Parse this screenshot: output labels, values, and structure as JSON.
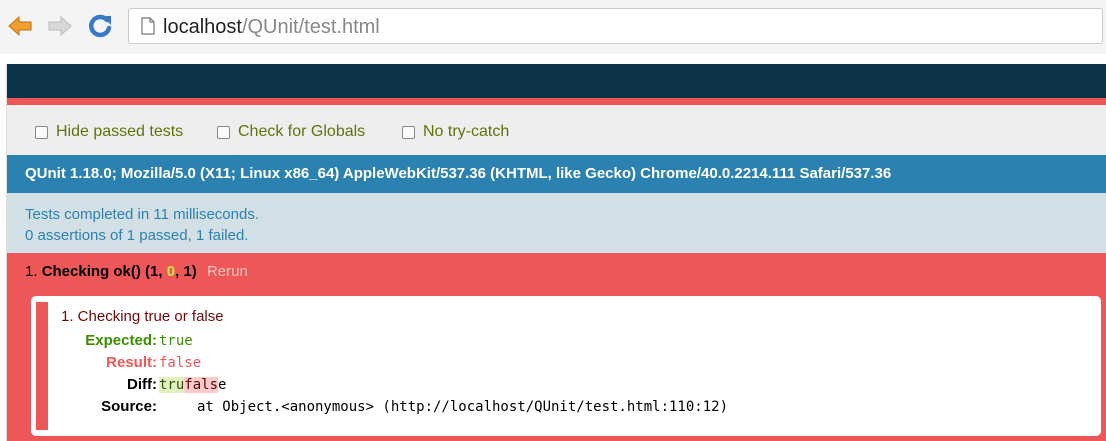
{
  "browser": {
    "url_host": "localhost",
    "url_path": "/QUnit/test.html"
  },
  "qunit": {
    "options": [
      {
        "label": "Hide passed tests",
        "checked": false
      },
      {
        "label": "Check for Globals",
        "checked": false
      },
      {
        "label": "No try-catch",
        "checked": false
      }
    ],
    "user_agent": "QUnit 1.18.0; Mozilla/5.0 (X11; Linux x86_64) AppleWebKit/537.36 (KHTML, like Gecko) Chrome/40.0.2214.111 Safari/537.36",
    "result_line1": "Tests completed in 11 milliseconds.",
    "result_line2": "0 assertions of 1 passed, 1 failed.",
    "test": {
      "number": "1.",
      "name": "Checking ok()",
      "failed_count": "1",
      "passed_count": "0",
      "total_count": "1",
      "rerun_label": "Rerun",
      "assertion": {
        "message": "1. Checking true or false",
        "expected_label": "Expected:",
        "expected_value": "true",
        "result_label": "Result:",
        "result_value": "false",
        "diff_label": "Diff:",
        "diff_inserted": "tru",
        "diff_deleted": "fals",
        "diff_common": "e",
        "source_label": "Source:",
        "source_value": "at Object.<anonymous> (http://localhost/QUnit/test.html:110:12)"
      }
    }
  },
  "colors": {
    "header": "#0d3349",
    "banner_fail": "#ee5757",
    "useragent_bg": "#2b81af",
    "result_bg": "#d2e0e6",
    "option_text": "#5e740b"
  }
}
